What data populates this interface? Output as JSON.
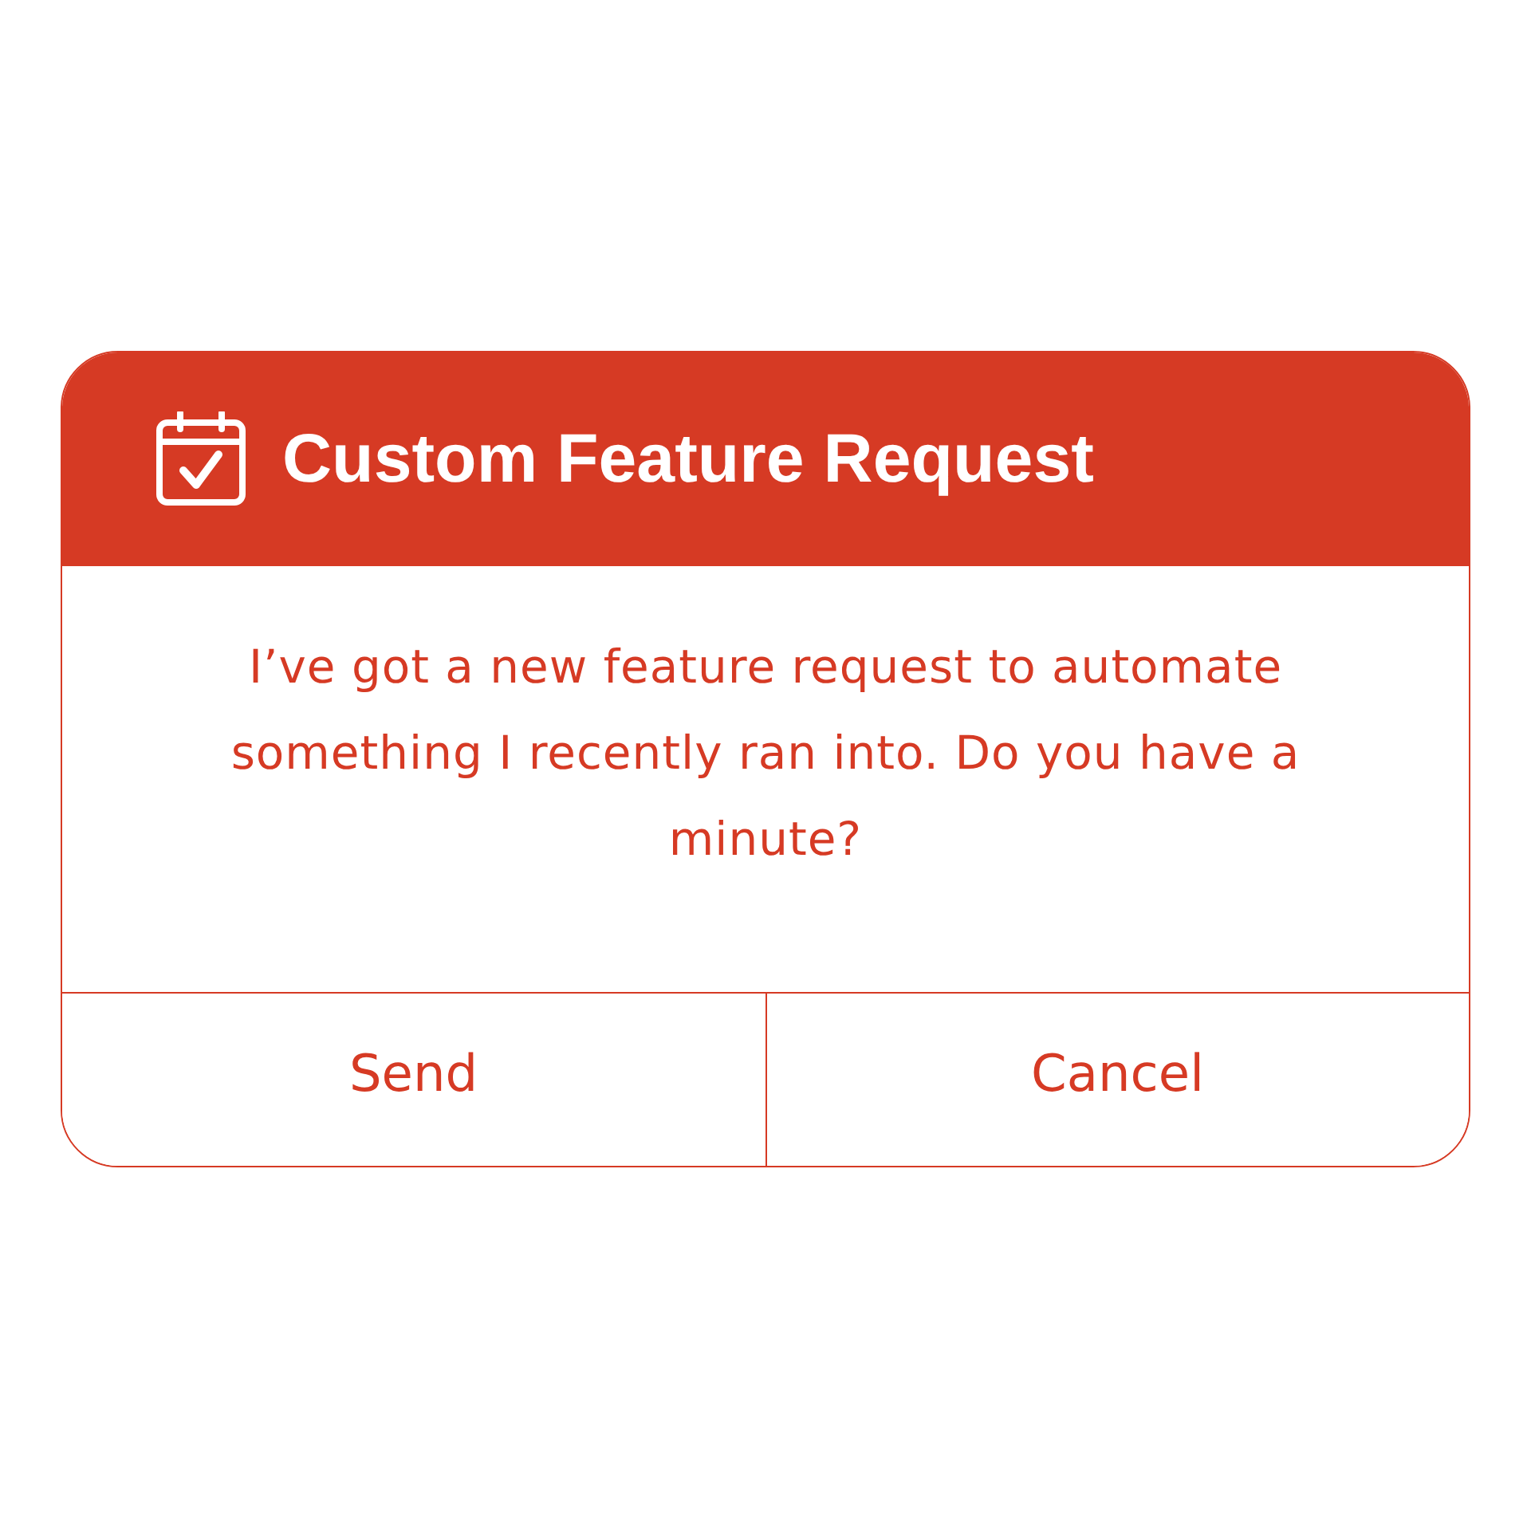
{
  "dialog": {
    "title": "Custom Feature Request",
    "message": "I’ve got a new feature request to automate something I recently ran into. Do you have a minute?",
    "buttons": [
      "Send",
      "Cancel"
    ]
  }
}
